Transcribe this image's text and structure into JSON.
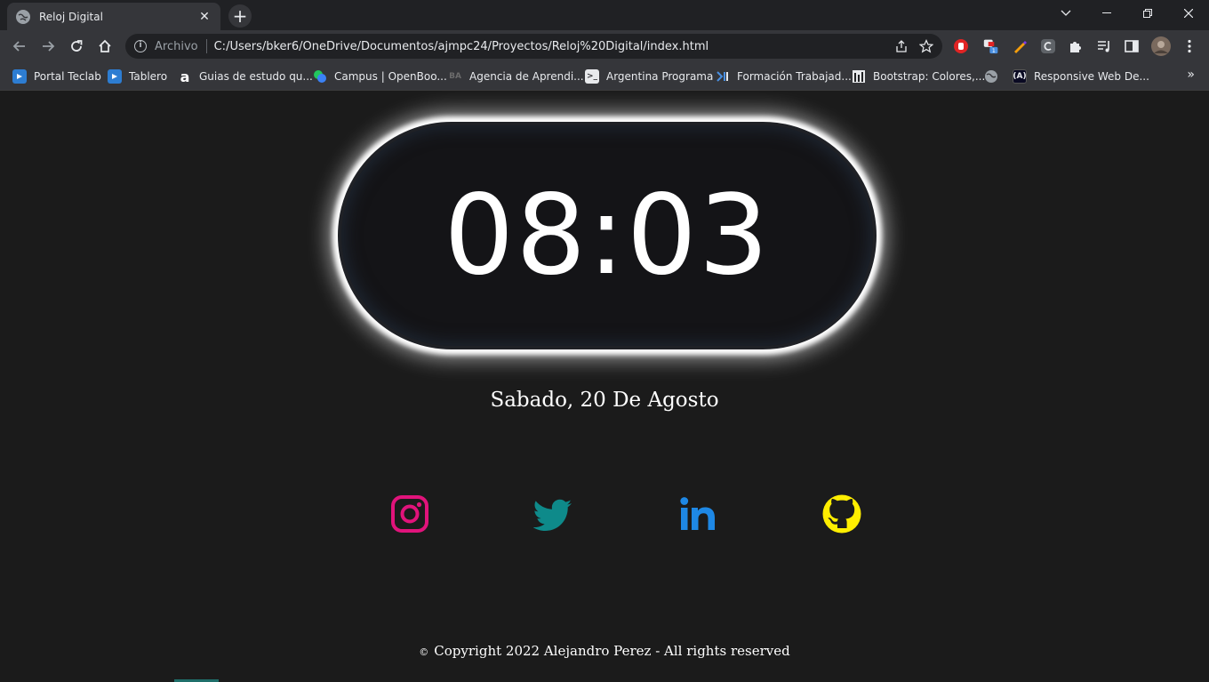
{
  "browser": {
    "tab_title": "Reloj Digital",
    "omnibox": {
      "scheme_label": "Archivo",
      "url": "C:/Users/bker6/OneDrive/Documentos/ajmpc24/Proyectos/Reloj%20Digital/index.html"
    },
    "extension_badge": "1",
    "bookmarks": [
      {
        "label": "Portal Teclab",
        "icon": "teclab-icon",
        "color": "#2d7dd2"
      },
      {
        "label": "Tablero",
        "icon": "teclab-icon",
        "color": "#2d7dd2"
      },
      {
        "label": "Guias de estudo qu...",
        "icon": "a-icon",
        "color": "#ffffff"
      },
      {
        "label": "Campus | OpenBoo...",
        "icon": "openbootcamp-icon",
        "color": "#22c55e"
      },
      {
        "label": "Agencia de Aprendi...",
        "icon": "ba-icon",
        "color": "#6b6b6b"
      },
      {
        "label": "Argentina Programa",
        "icon": "terminal-icon",
        "color": "#ffffff"
      },
      {
        "label": "Formación Trabajad...",
        "icon": "formacion-icon",
        "color": "#4a90e2"
      },
      {
        "label": "Bootstrap: Colores,...",
        "icon": "bootstrap-icon",
        "color": "#ffffff"
      },
      {
        "label": "",
        "icon": "globe-icon",
        "color": "#9aa0a6"
      },
      {
        "label": "Responsive Web De...",
        "icon": "freecodecamp-icon",
        "color": "#0a0a23"
      }
    ]
  },
  "page": {
    "time": "08:03",
    "date": "Sabado, 20 De Agosto",
    "social": [
      {
        "name": "instagram",
        "icon": "instagram-icon",
        "color": "#e1137b"
      },
      {
        "name": "twitter",
        "icon": "twitter-icon",
        "color": "#0e8a8a"
      },
      {
        "name": "linkedin",
        "icon": "linkedin-icon",
        "color": "#1e88e5"
      },
      {
        "name": "github",
        "icon": "github-icon",
        "color": "#ffee00"
      }
    ],
    "footer": {
      "symbol": "©",
      "text": "Copyright 2022 Alejandro Perez - All rights reserved"
    }
  }
}
